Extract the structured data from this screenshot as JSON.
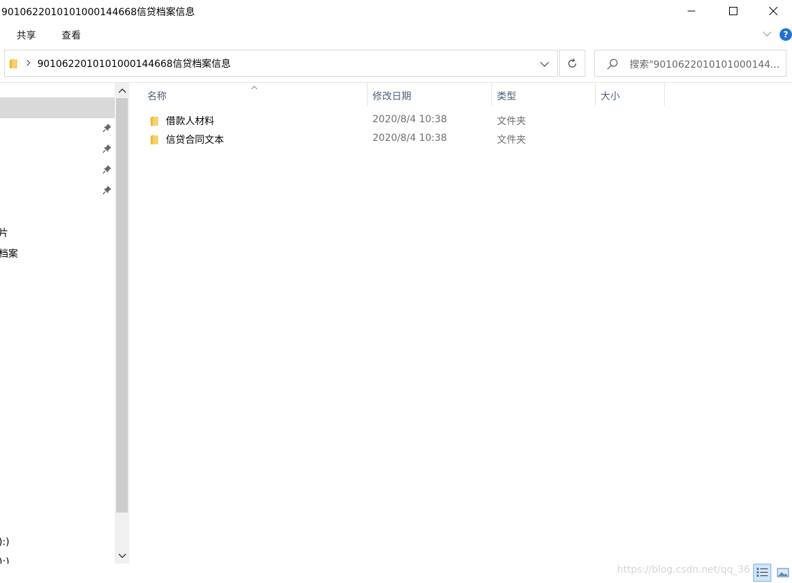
{
  "window": {
    "title": "9010622010101000144668信贷档案信息"
  },
  "ribbon": {
    "tabs": [
      {
        "label": "共享"
      },
      {
        "label": "查看"
      }
    ],
    "help_label": "?"
  },
  "address": {
    "path": "9010622010101000144668信贷档案信息"
  },
  "search": {
    "placeholder": "搜索\"9010622010101000144..."
  },
  "nav": {
    "labels": [
      "片",
      "档案",
      "):)",
      "):)"
    ]
  },
  "columns": {
    "name": "名称",
    "date": "修改日期",
    "type": "类型",
    "size": "大小"
  },
  "files": [
    {
      "name": "借款人材料",
      "date": "2020/8/4 10:38",
      "type": "文件夹"
    },
    {
      "name": "信贷合同文本",
      "date": "2020/8/4 10:38",
      "type": "文件夹"
    }
  ],
  "watermark": "https://blog.csdn.net/qq_36",
  "colors": {
    "folder": "#f7d26b",
    "header_text": "#4c607a",
    "selection": "#d9d9d9",
    "accent": "#1f73d1"
  }
}
